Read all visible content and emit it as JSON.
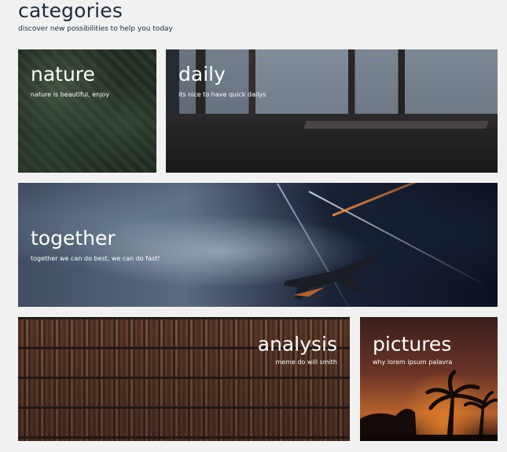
{
  "header": {
    "title": "categories",
    "subtitle": "discover new possibilities to help you today"
  },
  "cards": {
    "nature": {
      "title": "nature",
      "subtitle": "nature is beautiful, enjoy"
    },
    "daily": {
      "title": "daily",
      "subtitle": "its nice to have quick dailys"
    },
    "together": {
      "title": "together",
      "subtitle": "together we can do best, we can do fast!"
    },
    "analysis": {
      "title": "analysis",
      "subtitle": "meme do will smith"
    },
    "pictures": {
      "title": "pictures",
      "subtitle": "why lorem ipsum palavra"
    }
  },
  "colors": {
    "background": "#f1f1f1",
    "heading": "#1d2b3c",
    "card_text": "#ffffff"
  }
}
